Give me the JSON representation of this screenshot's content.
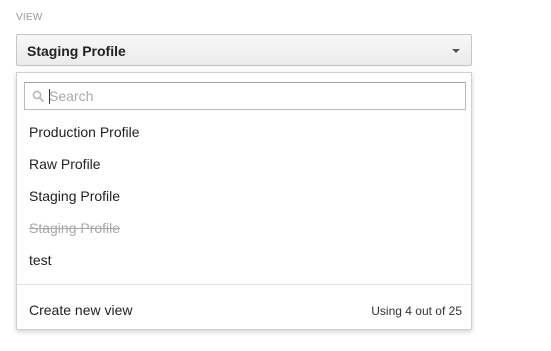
{
  "view_section": {
    "label": "VIEW",
    "selected": "Staging Profile"
  },
  "dropdown": {
    "search": {
      "placeholder": "Search",
      "value": ""
    },
    "options": [
      {
        "label": "Production Profile",
        "disabled": false
      },
      {
        "label": "Raw Profile",
        "disabled": false
      },
      {
        "label": "Staging Profile",
        "disabled": false
      },
      {
        "label": "Staging Profile",
        "disabled": true
      },
      {
        "label": "test",
        "disabled": false
      }
    ],
    "footer": {
      "create_label": "Create new view",
      "usage_text": "Using 4 out of 25"
    }
  },
  "icons": {
    "search": "search-icon",
    "caret": "chevron-down-icon"
  }
}
